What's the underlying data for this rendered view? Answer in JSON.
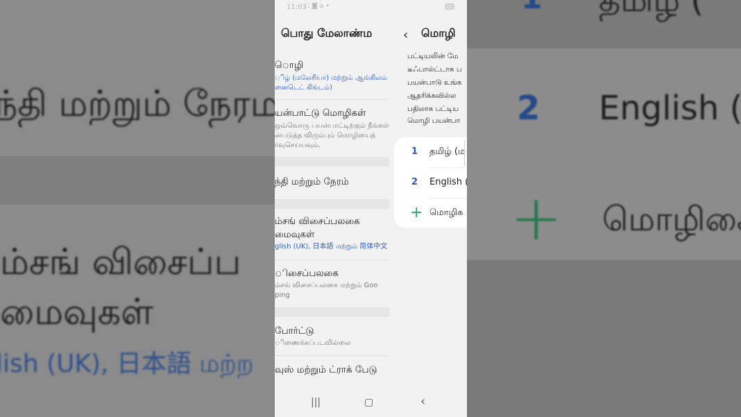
{
  "background_left": {
    "line1": "ந்தி மற்றும் நேரம",
    "line2": "ம்சங் விசைப்ப",
    "line3": "மைவுகள்",
    "line4": "lish (UK), 日本語 மற்ற"
  },
  "background_right": {
    "top_text": "தமிழ் (",
    "row2_num": "2",
    "row2_name": "English (U",
    "row3_name": "மொழிகை",
    "top_num": "1"
  },
  "status_bar": {
    "time": "11:03",
    "icons": "⛶ ◙ ⌂ •",
    "battery": "52"
  },
  "general_management": {
    "title": "பொது மேலாண்ம",
    "items": [
      {
        "title": "ொழி",
        "subtitle_1": "ிழ் (மலேசியா) மற்றும் ஆங்கிலம்",
        "subtitle_2": "னைடெட் கிங்டம்)"
      },
      {
        "title": "யன்பாட்டு மொழிகள்",
        "subtitle_1": "ஒவ்வொரு பயன்பாட்டிற்கும் நீங்கள்",
        "subtitle_2": "ன்படுத்த விரும்பும் மொழியைத்",
        "subtitle_3": "ர்வுசெய்யவும்."
      },
      {
        "title": "ந்தி மற்றும் நேரம்"
      },
      {
        "title": "ம்சங் விசைப்பலகை",
        "title_2": "மைவுகள்",
        "subtitle_1": "glish (UK), 日本語 மற்றும் 简体中文 (ம"
      },
      {
        "title": "ிசைப்பலகை",
        "subtitle_1": "ம்சங் விசைப்பலகை மற்றும் Goo",
        "subtitle_2": "ping"
      },
      {
        "title": "போர்ட்டு",
        "subtitle_1": "ிணைக்கப்படவில்லை"
      },
      {
        "title": "வுஸ் மற்றும் ட்ராக் பேடு"
      }
    ]
  },
  "language_page": {
    "title": "மொழி",
    "description": [
      "பட்டியலின் மே",
      "டீஃபால்ட்டாக ப",
      "பயன்பாடு உங்க",
      "ஆதரிக்கவில்ல",
      "பதிலாக பட்டிய",
      "மொழி பயன்பா"
    ],
    "languages": [
      {
        "num": "1",
        "name": "தமிழ் (ம"
      },
      {
        "num": "2",
        "name": "English (U"
      }
    ],
    "add_label": "மொழிக"
  },
  "nav": {
    "recents": "|||",
    "home": "▢",
    "back": "‹"
  }
}
